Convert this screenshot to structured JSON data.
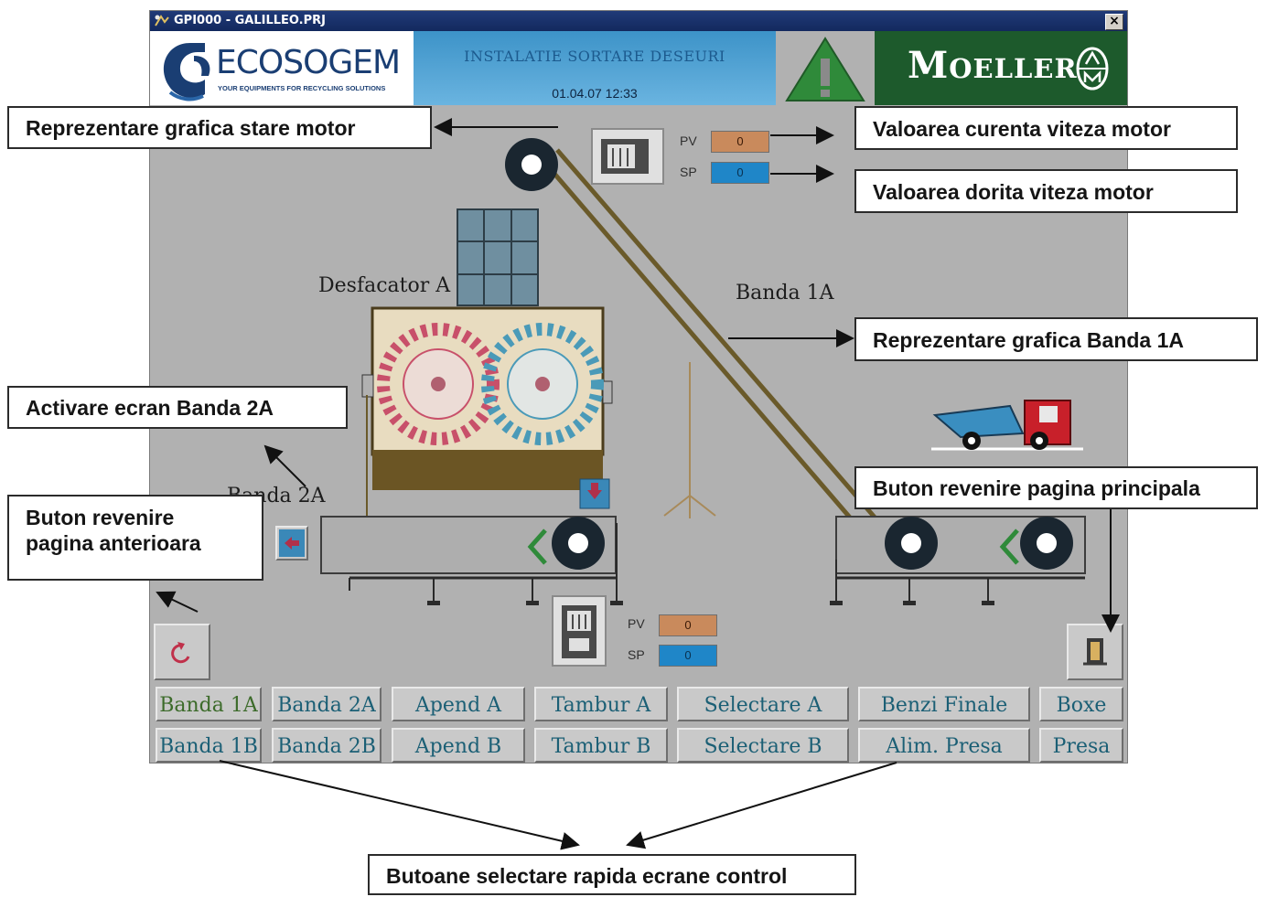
{
  "window": {
    "title": "GPI000 - GALILLEO.PRJ",
    "close_glyph": "×"
  },
  "header": {
    "logo_name": "ECOSOGEM",
    "logo_tagline": "YOUR EQUIPMENTS FOR RECYCLING SOLUTIONS",
    "hmi_title": "INSTALATIE SORTARE DESEURI",
    "datetime": "01.04.07 12:33",
    "alarm_icon": "warning-triangle-icon",
    "brand_big": "M",
    "brand_rest": "OELLER"
  },
  "motor_top": {
    "pv_label": "PV",
    "pv_value": "0",
    "sp_label": "SP",
    "sp_value": "0"
  },
  "motor_bottom": {
    "pv_label": "PV",
    "pv_value": "0",
    "sp_label": "SP",
    "sp_value": "0"
  },
  "process_labels": {
    "desfacator": "Desfacator A",
    "banda_1a": "Banda 1A",
    "banda_2a": "Banda 2A"
  },
  "nav": {
    "row1": [
      "Banda 1A",
      "Banda 2A",
      "Apend A",
      "Tambur A",
      "Selectare A",
      "Benzi Finale",
      "Boxe"
    ],
    "row2": [
      "Banda 1B",
      "Banda 2B",
      "Apend B",
      "Tambur B",
      "Selectare B",
      "Alim. Presa",
      "Presa"
    ]
  },
  "annotations": {
    "motor_state": "Reprezentare grafica stare motor",
    "current_speed": "Valoarea curenta viteza motor",
    "desired_speed": "Valoarea dorita viteza motor",
    "banda_graphic": "Reprezentare grafica Banda 1A",
    "activate_2a": "Activare ecran Banda 2A",
    "main_page": "Buton revenire pagina principala",
    "prev_page_line1": "Buton revenire",
    "prev_page_line2": "pagina anterioara",
    "quick_select": "Butoane selectare rapida ecrane control"
  },
  "colors": {
    "panel": "#b1b1b1",
    "pv": "#c98a5c",
    "sp": "#1f86c8",
    "brand_green": "#1d5a2c",
    "header_blue": "#3d93c8"
  }
}
